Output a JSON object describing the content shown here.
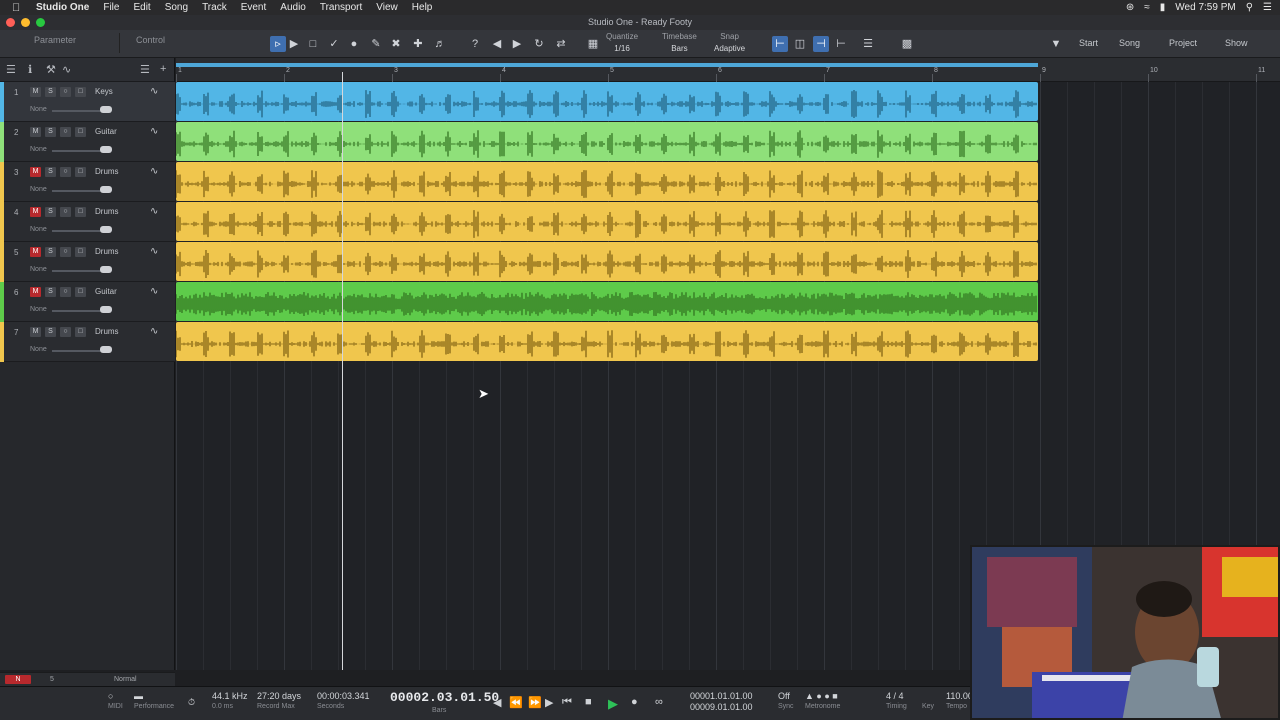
{
  "menubar": {
    "apple": "",
    "app_name": "Studio One",
    "items": [
      "File",
      "Edit",
      "Song",
      "Track",
      "Event",
      "Audio",
      "Transport",
      "View",
      "Help"
    ],
    "clock": "Wed 7:59 PM"
  },
  "window": {
    "title": "Studio One - Ready Footy"
  },
  "toolbar": {
    "parameter_label": "Parameter",
    "control_label": "Control",
    "quantize_label": "Quantize",
    "quantize_value": "1/16",
    "timebase_label": "Timebase",
    "timebase_value": "Bars",
    "snap_label": "Snap",
    "snap_value": "Adaptive",
    "start": "Start",
    "song": "Song",
    "project": "Project",
    "show": "Show"
  },
  "ruler": {
    "bars": [
      "1",
      "2",
      "3",
      "4",
      "5",
      "6",
      "7",
      "8",
      "9",
      "10",
      "11"
    ]
  },
  "tracks": [
    {
      "num": "1",
      "name": "Keys",
      "io": "None",
      "muted": false,
      "color": "#52b6e6"
    },
    {
      "num": "2",
      "name": "Guitar",
      "io": "None",
      "muted": false,
      "color": "#8fe07a"
    },
    {
      "num": "3",
      "name": "Drums",
      "io": "None",
      "muted": true,
      "color": "#f0c64d"
    },
    {
      "num": "4",
      "name": "Drums",
      "io": "None",
      "muted": true,
      "color": "#f0c64d"
    },
    {
      "num": "5",
      "name": "Drums",
      "io": "None",
      "muted": true,
      "color": "#f0c64d"
    },
    {
      "num": "6",
      "name": "Guitar",
      "io": "None",
      "muted": true,
      "color": "#5ecb4a"
    },
    {
      "num": "7",
      "name": "Drums",
      "io": "None",
      "muted": false,
      "color": "#f0c64d"
    }
  ],
  "mute_label": "M",
  "solo_label": "S",
  "panel_footer": {
    "badge": "N",
    "num": "5",
    "mode": "Normal"
  },
  "transport": {
    "sample_rate": "44.1 kHz",
    "latency": "0.0 ms",
    "record_max": "27:20 days",
    "record_max_label": "Record Max",
    "seconds": "00:00:03.341",
    "seconds_label": "Seconds",
    "position": "00002.03.01.50",
    "position_label": "Bars",
    "left_locator": "00001.01.01.00",
    "right_locator": "00009.01.01.00",
    "sync": "Off",
    "sync_label": "Sync",
    "metronome_label": "Metronome",
    "timing": "4 / 4",
    "timing_label": "Timing",
    "key_label": "Key",
    "tempo": "110.00",
    "tempo_label": "Tempo",
    "midi_label": "MIDI",
    "performance_label": "Performance"
  }
}
